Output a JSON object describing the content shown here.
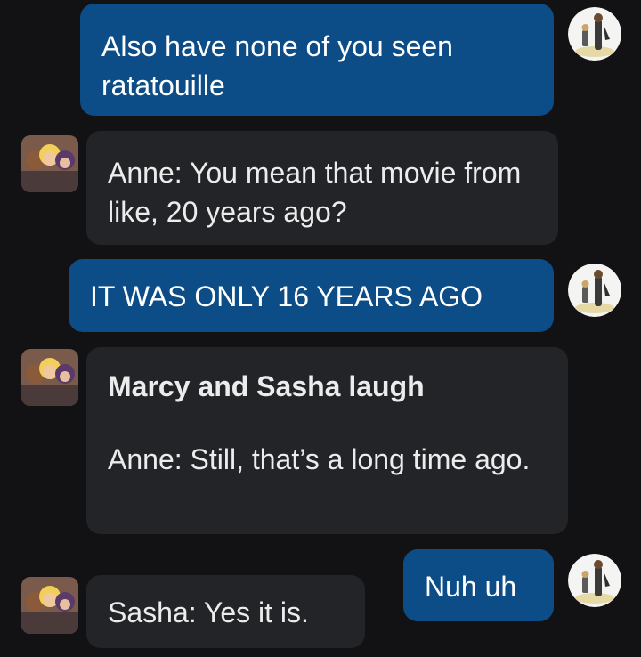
{
  "messages": [
    {
      "sender": "self",
      "text": "Also have none of you seen ratatouille"
    },
    {
      "sender": "bot",
      "text": "Anne: You mean that movie from like, 20 years ago?"
    },
    {
      "sender": "self",
      "text": "IT WAS ONLY 16 YEARS AGO"
    },
    {
      "sender": "bot",
      "action": "Marcy and Sasha laugh",
      "text": "Anne: Still, that’s a long time ago."
    },
    {
      "sender": "self",
      "text": "Nuh uh"
    },
    {
      "sender": "bot",
      "text": "Sasha: Yes it is."
    }
  ],
  "colors": {
    "background": "#121214",
    "outgoing_bubble": "#0c4d87",
    "incoming_bubble": "#232428",
    "text": "#ececec"
  },
  "icons": {
    "self_avatar": "user-avatar-icon",
    "bot_avatar": "group-avatar-icon"
  }
}
